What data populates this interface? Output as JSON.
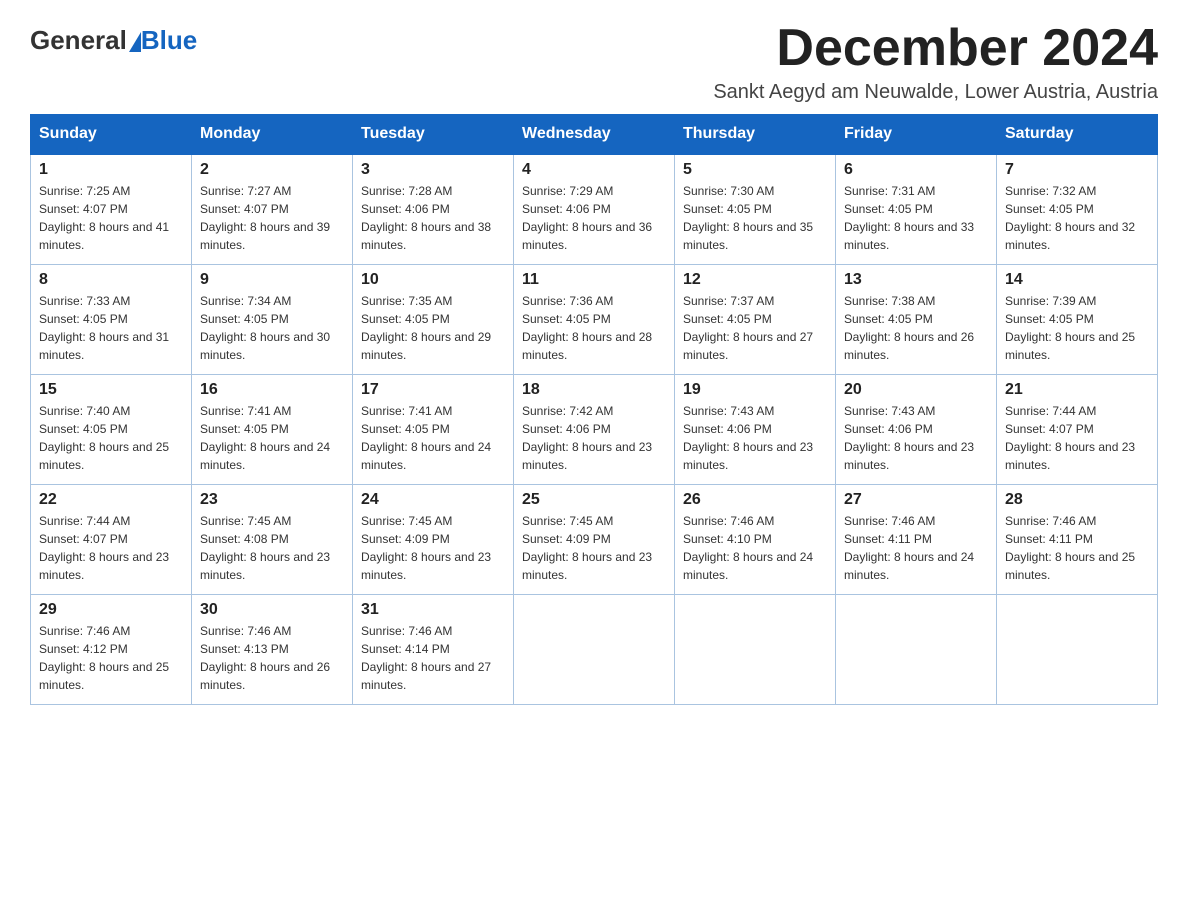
{
  "header": {
    "logo_general": "General",
    "logo_blue": "Blue",
    "month_year": "December 2024",
    "location": "Sankt Aegyd am Neuwalde, Lower Austria, Austria"
  },
  "days_of_week": [
    "Sunday",
    "Monday",
    "Tuesday",
    "Wednesday",
    "Thursday",
    "Friday",
    "Saturday"
  ],
  "weeks": [
    [
      {
        "day": "1",
        "sunrise": "7:25 AM",
        "sunset": "4:07 PM",
        "daylight": "8 hours and 41 minutes."
      },
      {
        "day": "2",
        "sunrise": "7:27 AM",
        "sunset": "4:07 PM",
        "daylight": "8 hours and 39 minutes."
      },
      {
        "day": "3",
        "sunrise": "7:28 AM",
        "sunset": "4:06 PM",
        "daylight": "8 hours and 38 minutes."
      },
      {
        "day": "4",
        "sunrise": "7:29 AM",
        "sunset": "4:06 PM",
        "daylight": "8 hours and 36 minutes."
      },
      {
        "day": "5",
        "sunrise": "7:30 AM",
        "sunset": "4:05 PM",
        "daylight": "8 hours and 35 minutes."
      },
      {
        "day": "6",
        "sunrise": "7:31 AM",
        "sunset": "4:05 PM",
        "daylight": "8 hours and 33 minutes."
      },
      {
        "day": "7",
        "sunrise": "7:32 AM",
        "sunset": "4:05 PM",
        "daylight": "8 hours and 32 minutes."
      }
    ],
    [
      {
        "day": "8",
        "sunrise": "7:33 AM",
        "sunset": "4:05 PM",
        "daylight": "8 hours and 31 minutes."
      },
      {
        "day": "9",
        "sunrise": "7:34 AM",
        "sunset": "4:05 PM",
        "daylight": "8 hours and 30 minutes."
      },
      {
        "day": "10",
        "sunrise": "7:35 AM",
        "sunset": "4:05 PM",
        "daylight": "8 hours and 29 minutes."
      },
      {
        "day": "11",
        "sunrise": "7:36 AM",
        "sunset": "4:05 PM",
        "daylight": "8 hours and 28 minutes."
      },
      {
        "day": "12",
        "sunrise": "7:37 AM",
        "sunset": "4:05 PM",
        "daylight": "8 hours and 27 minutes."
      },
      {
        "day": "13",
        "sunrise": "7:38 AM",
        "sunset": "4:05 PM",
        "daylight": "8 hours and 26 minutes."
      },
      {
        "day": "14",
        "sunrise": "7:39 AM",
        "sunset": "4:05 PM",
        "daylight": "8 hours and 25 minutes."
      }
    ],
    [
      {
        "day": "15",
        "sunrise": "7:40 AM",
        "sunset": "4:05 PM",
        "daylight": "8 hours and 25 minutes."
      },
      {
        "day": "16",
        "sunrise": "7:41 AM",
        "sunset": "4:05 PM",
        "daylight": "8 hours and 24 minutes."
      },
      {
        "day": "17",
        "sunrise": "7:41 AM",
        "sunset": "4:05 PM",
        "daylight": "8 hours and 24 minutes."
      },
      {
        "day": "18",
        "sunrise": "7:42 AM",
        "sunset": "4:06 PM",
        "daylight": "8 hours and 23 minutes."
      },
      {
        "day": "19",
        "sunrise": "7:43 AM",
        "sunset": "4:06 PM",
        "daylight": "8 hours and 23 minutes."
      },
      {
        "day": "20",
        "sunrise": "7:43 AM",
        "sunset": "4:06 PM",
        "daylight": "8 hours and 23 minutes."
      },
      {
        "day": "21",
        "sunrise": "7:44 AM",
        "sunset": "4:07 PM",
        "daylight": "8 hours and 23 minutes."
      }
    ],
    [
      {
        "day": "22",
        "sunrise": "7:44 AM",
        "sunset": "4:07 PM",
        "daylight": "8 hours and 23 minutes."
      },
      {
        "day": "23",
        "sunrise": "7:45 AM",
        "sunset": "4:08 PM",
        "daylight": "8 hours and 23 minutes."
      },
      {
        "day": "24",
        "sunrise": "7:45 AM",
        "sunset": "4:09 PM",
        "daylight": "8 hours and 23 minutes."
      },
      {
        "day": "25",
        "sunrise": "7:45 AM",
        "sunset": "4:09 PM",
        "daylight": "8 hours and 23 minutes."
      },
      {
        "day": "26",
        "sunrise": "7:46 AM",
        "sunset": "4:10 PM",
        "daylight": "8 hours and 24 minutes."
      },
      {
        "day": "27",
        "sunrise": "7:46 AM",
        "sunset": "4:11 PM",
        "daylight": "8 hours and 24 minutes."
      },
      {
        "day": "28",
        "sunrise": "7:46 AM",
        "sunset": "4:11 PM",
        "daylight": "8 hours and 25 minutes."
      }
    ],
    [
      {
        "day": "29",
        "sunrise": "7:46 AM",
        "sunset": "4:12 PM",
        "daylight": "8 hours and 25 minutes."
      },
      {
        "day": "30",
        "sunrise": "7:46 AM",
        "sunset": "4:13 PM",
        "daylight": "8 hours and 26 minutes."
      },
      {
        "day": "31",
        "sunrise": "7:46 AM",
        "sunset": "4:14 PM",
        "daylight": "8 hours and 27 minutes."
      },
      null,
      null,
      null,
      null
    ]
  ]
}
